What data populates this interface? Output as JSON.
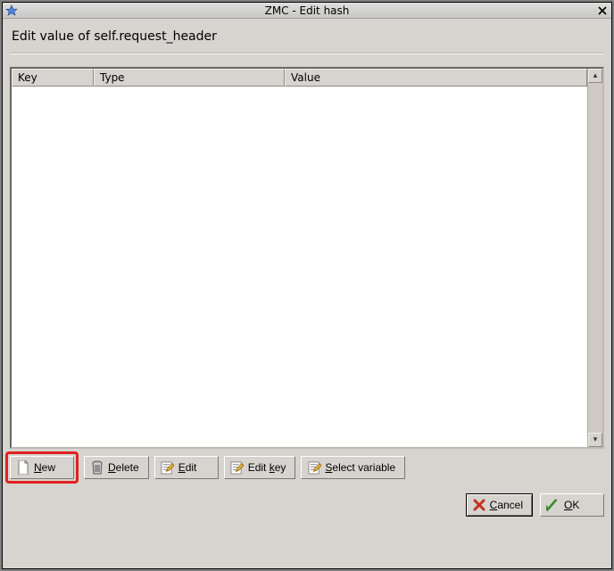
{
  "window": {
    "title": "ZMC - Edit hash"
  },
  "heading": "Edit value of self.request_header",
  "table": {
    "columns": {
      "key": "Key",
      "type": "Type",
      "value": "Value"
    },
    "rows": []
  },
  "actions": {
    "new": {
      "label": "New",
      "accel": "N",
      "after": "ew"
    },
    "delete": {
      "label": "Delete",
      "accel": "D",
      "after": "elete"
    },
    "edit": {
      "label": "Edit",
      "accel": "E",
      "after": "dit"
    },
    "editkey": {
      "label_pre": "Edit ",
      "accel": "k",
      "after": "ey"
    },
    "selvar": {
      "accel": "S",
      "after": "elect variable"
    }
  },
  "footer": {
    "cancel": {
      "accel": "C",
      "after": "ancel"
    },
    "ok": {
      "accel": "O",
      "after": "K"
    }
  }
}
